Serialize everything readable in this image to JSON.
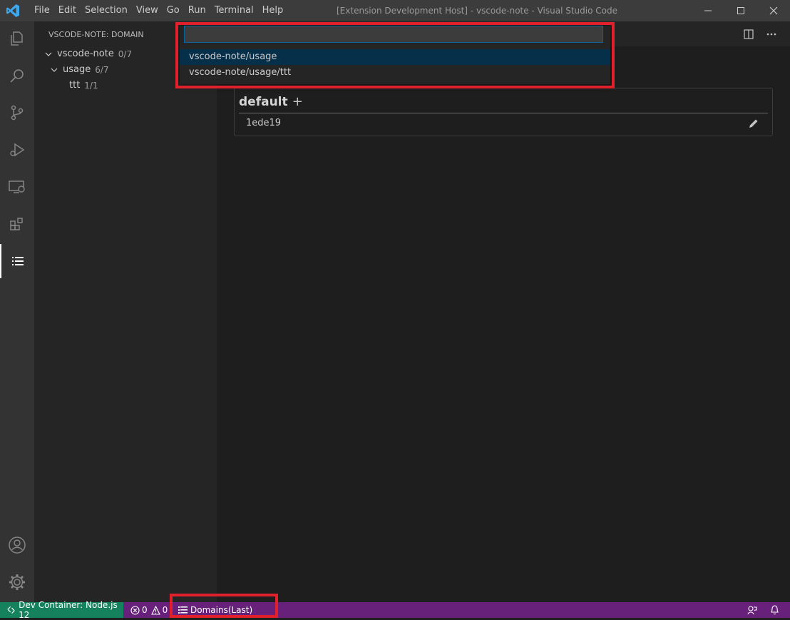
{
  "window": {
    "title": "[Extension Development Host] - vscode-note - Visual Studio Code",
    "menu": [
      {
        "label": "File"
      },
      {
        "label": "Edit"
      },
      {
        "label": "Selection"
      },
      {
        "label": "View"
      },
      {
        "label": "Go"
      },
      {
        "label": "Run"
      },
      {
        "label": "Terminal"
      },
      {
        "label": "Help"
      }
    ]
  },
  "activity_bar": {
    "items": [
      "explorer-icon",
      "search-icon",
      "source-control-icon",
      "run-debug-icon",
      "remote-explorer-icon",
      "extensions-icon",
      "vscode-note-icon"
    ],
    "bottom": [
      "accounts-icon",
      "settings-gear-icon"
    ]
  },
  "sidebar": {
    "title": "VSCODE-NOTE: DOMAIN",
    "tree": [
      {
        "label": "vscode-note",
        "count": "0/7"
      },
      {
        "label": "usage",
        "count": "6/7"
      },
      {
        "label": "ttt",
        "count": "1/1"
      }
    ]
  },
  "editor": {
    "card": {
      "title": "default",
      "plus": "+",
      "note": "1ede19"
    }
  },
  "quick_pick": {
    "value": "",
    "items": [
      {
        "label": "vscode-note/usage"
      },
      {
        "label": "vscode-note/usage/ttt"
      }
    ]
  },
  "status_bar": {
    "remote": "Dev Container: Node.js 12",
    "errors": "0",
    "warnings": "0",
    "domains": "Domains(Last)"
  },
  "colors": {
    "accent": "#007acc",
    "status_bar": "#68217a",
    "remote": "#16825d",
    "highlight_box": "#e0202a"
  }
}
